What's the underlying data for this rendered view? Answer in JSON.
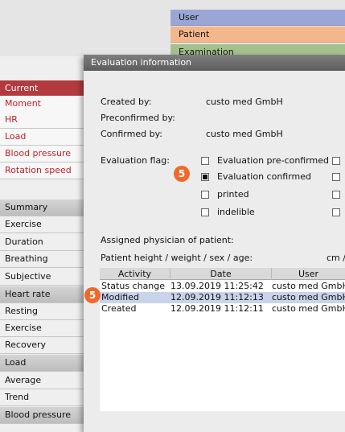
{
  "top_tabs": {
    "user": "User",
    "patient": "Patient",
    "examination": "Examination"
  },
  "left_items": [
    {
      "label": "Current",
      "kind": "sel"
    },
    {
      "label": "Moment",
      "kind": "red"
    },
    {
      "label": "HR",
      "kind": "red"
    },
    {
      "label": "Load",
      "kind": "red"
    },
    {
      "label": "Blood pressure",
      "kind": "red"
    },
    {
      "label": "Rotation speed",
      "kind": "red"
    },
    {
      "label": "Summary",
      "kind": "hdr"
    },
    {
      "label": "Exercise",
      "kind": "plain"
    },
    {
      "label": "Duration",
      "kind": "plain"
    },
    {
      "label": "Breathing",
      "kind": "plain"
    },
    {
      "label": "Subjective",
      "kind": "plain"
    },
    {
      "label": "Heart rate",
      "kind": "hdr"
    },
    {
      "label": "Resting",
      "kind": "plain"
    },
    {
      "label": "Exercise",
      "kind": "plain"
    },
    {
      "label": "Recovery",
      "kind": "plain"
    },
    {
      "label": "Load",
      "kind": "hdr"
    },
    {
      "label": "Average",
      "kind": "plain"
    },
    {
      "label": "Trend",
      "kind": "plain"
    },
    {
      "label": "Blood pressure",
      "kind": "hdr"
    }
  ],
  "dialog": {
    "title": "Evaluation information",
    "created_by_label": "Created by:",
    "created_by_value": "custo med GmbH",
    "preconfirmed_label": "Preconfirmed by:",
    "confirmed_by_label": "Confirmed by:",
    "confirmed_by_value": "custo med GmbH",
    "flag_label": "Evaluation flag:",
    "flags": [
      {
        "label": "Evaluation pre-confirmed",
        "checked": false
      },
      {
        "label": "Evaluation confirmed",
        "checked": true
      },
      {
        "label": "printed",
        "checked": false
      },
      {
        "label": "indelible",
        "checked": false
      }
    ],
    "physician_label": "Assigned physician of patient:",
    "patient_hw_label": "Patient height / weight / sex / age:",
    "patient_hw_unit": "cm /",
    "badge": "5"
  },
  "table": {
    "headers": [
      "Activity",
      "Date",
      "User"
    ],
    "rows": [
      {
        "activity": "Status change",
        "date": "13.09.2019 11:25:42",
        "user": "custo med GmbH"
      },
      {
        "activity": "Modified",
        "date": "12.09.2019 11:12:13",
        "user": "custo med GmbH"
      },
      {
        "activity": "Created",
        "date": "12.09.2019 11:12:11",
        "user": "custo med GmbH"
      }
    ],
    "highlighted_row": 1
  },
  "colors": {
    "user_tab": "#9aa7d6",
    "patient_tab": "#f4b78c",
    "exam_tab": "#a3c08e",
    "selected_item": "#b33a3e",
    "badge": "#ef6a2a"
  }
}
